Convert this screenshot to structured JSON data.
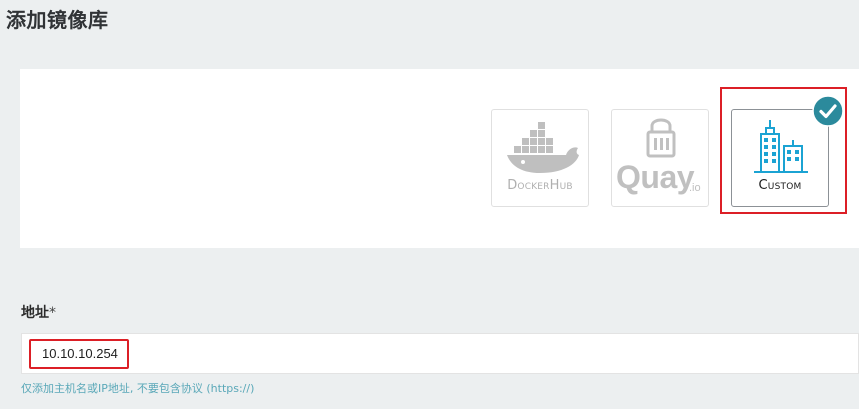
{
  "page": {
    "title": "添加镜像库"
  },
  "providers": [
    {
      "id": "dockerhub",
      "label": "DockerHub",
      "selected": false,
      "icon": "docker-whale-icon"
    },
    {
      "id": "quay",
      "label": "Quay",
      "suffix": ".io",
      "selected": false,
      "icon": "quay-lock-icon"
    },
    {
      "id": "custom",
      "label": "Custom",
      "selected": true,
      "icon": "buildings-icon"
    }
  ],
  "form": {
    "address_label": "地址",
    "required_mark": "*",
    "address_value": "10.10.10.254",
    "address_help": "仅添加主机名或IP地址, 不要包含协议 (https://)"
  },
  "colors": {
    "background": "#eceff0",
    "accent_teal": "#2b8a9c",
    "custom_icon": "#1ba3d3",
    "highlight_red": "#dc1f26",
    "help_text": "#5aa8b8"
  }
}
